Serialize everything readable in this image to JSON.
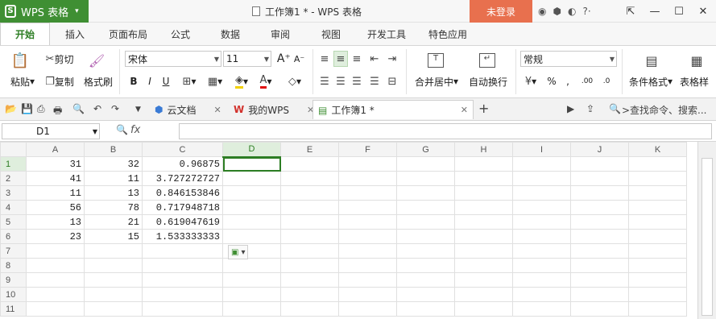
{
  "title": {
    "app_name": "WPS 表格",
    "document_title": "工作簿1 * - WPS 表格",
    "login": "未登录",
    "icons": [
      "skin-icon",
      "share-icon",
      "theme-icon",
      "help-icon",
      "restore-icon",
      "minimize-icon",
      "maximize-icon",
      "close-icon"
    ]
  },
  "menu": {
    "tabs": [
      "开始",
      "插入",
      "页面布局",
      "公式",
      "数据",
      "审阅",
      "视图",
      "开发工具",
      "特色应用"
    ],
    "active": "开始"
  },
  "ribbon": {
    "paste": "粘贴",
    "cut": "剪切",
    "copy": "复制",
    "format_painter": "格式刷",
    "font_name": "宋体",
    "font_size": "11",
    "merge_center": "合并居中",
    "wrap_text": "自动换行",
    "number_format": "常规",
    "conditional_format": "条件格式",
    "table_format": "表格样",
    "percent": "%"
  },
  "quickbar": {
    "doc_tabs": [
      "云文档",
      "我的WPS",
      "工作簿1 *"
    ],
    "active_tab": "工作簿1 *",
    "search": ">查找命令、搜索..."
  },
  "formula_bar": {
    "name_box": "D1",
    "fx": "fx",
    "value": ""
  },
  "sheet": {
    "columns": [
      "A",
      "B",
      "C",
      "D",
      "E",
      "F",
      "G",
      "H",
      "I",
      "J",
      "K"
    ],
    "selected_column": "D",
    "selected_row": "1",
    "rows": [
      {
        "num": "1",
        "a": "31",
        "b": "32",
        "c": "0.96875"
      },
      {
        "num": "2",
        "a": "41",
        "b": "11",
        "c": "3.727272727"
      },
      {
        "num": "3",
        "a": "11",
        "b": "13",
        "c": "0.846153846"
      },
      {
        "num": "4",
        "a": "56",
        "b": "78",
        "c": "0.717948718"
      },
      {
        "num": "5",
        "a": "13",
        "b": "21",
        "c": "0.619047619"
      },
      {
        "num": "6",
        "a": "23",
        "b": "15",
        "c": "1.533333333"
      },
      {
        "num": "7",
        "a": "",
        "b": "",
        "c": ""
      },
      {
        "num": "8",
        "a": "",
        "b": "",
        "c": ""
      },
      {
        "num": "9",
        "a": "",
        "b": "",
        "c": ""
      },
      {
        "num": "10",
        "a": "",
        "b": "",
        "c": ""
      },
      {
        "num": "11",
        "a": "",
        "b": "",
        "c": ""
      }
    ]
  }
}
